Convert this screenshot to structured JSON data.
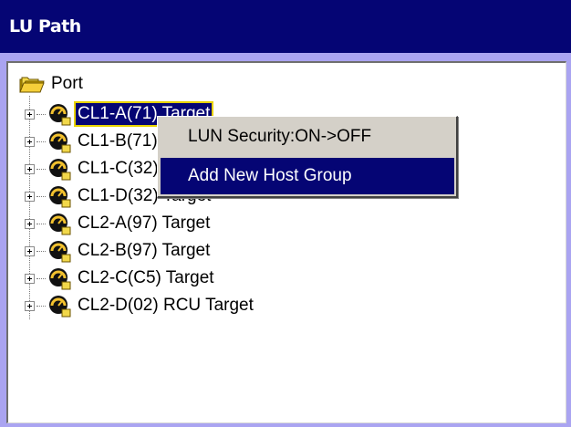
{
  "window": {
    "title": "LU Path"
  },
  "tree": {
    "root": {
      "label": "Port",
      "icon": "folder-open-icon"
    },
    "items": [
      {
        "label": "CL1-A(71) Target",
        "icon": "gauge-icon",
        "selected": true
      },
      {
        "label": "CL1-B(71) Target",
        "icon": "gauge-icon",
        "selected": false
      },
      {
        "label": "CL1-C(32) Target",
        "icon": "gauge-icon",
        "selected": false
      },
      {
        "label": "CL1-D(32) Target",
        "icon": "gauge-icon",
        "selected": false
      },
      {
        "label": "CL2-A(97) Target",
        "icon": "gauge-icon",
        "selected": false
      },
      {
        "label": "CL2-B(97) Target",
        "icon": "gauge-icon",
        "selected": false
      },
      {
        "label": "CL2-C(C5) Target",
        "icon": "gauge-icon",
        "selected": false
      },
      {
        "label": "CL2-D(02) RCU Target",
        "icon": "gauge-icon",
        "selected": false
      }
    ]
  },
  "context_menu": {
    "items": [
      {
        "label": "LUN Security:ON->OFF",
        "highlighted": false
      },
      {
        "label": "Add New Host Group",
        "highlighted": true
      }
    ]
  },
  "colors": {
    "title_bar": "#050574",
    "frame": "#aaa4f1",
    "selection": "#050574",
    "selection_outline": "#e8d200",
    "menu_background": "#d4d0c8"
  }
}
